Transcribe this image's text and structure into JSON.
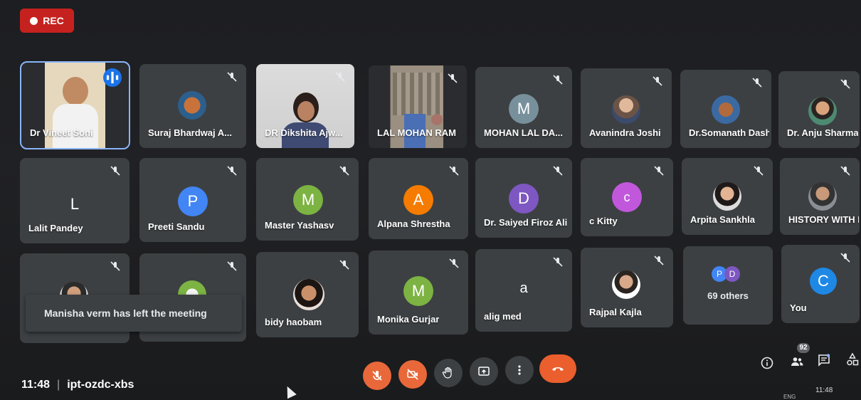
{
  "recording": {
    "label": "REC"
  },
  "participants": [
    {
      "name": "Dr Vineet Soni",
      "speaking": true
    },
    {
      "name": "Suraj Bhardwaj A..."
    },
    {
      "name": "DR Dikshita Ajw..."
    },
    {
      "name": "LAL MOHAN RAM"
    },
    {
      "name": "MOHAN LAL DA...",
      "initial": "M"
    },
    {
      "name": "Avanindra Joshi"
    },
    {
      "name": "Dr.Somanath Dash"
    },
    {
      "name": "Dr. Anju Sharma"
    },
    {
      "name": "Lalit Pandey",
      "initial": "L"
    },
    {
      "name": "Preeti Sandu",
      "initial": "P"
    },
    {
      "name": "Master Yashasv",
      "initial": "M"
    },
    {
      "name": "Alpana Shrestha",
      "initial": "A"
    },
    {
      "name": "Dr. Saiyed Firoz Ali",
      "initial": "D"
    },
    {
      "name": "c Kitty",
      "initial": "c"
    },
    {
      "name": "Arpita Sankhla"
    },
    {
      "name": "HISTORY WITH N..."
    },
    {
      "name": "bidy haobam"
    },
    {
      "name": "Monika Gurjar",
      "initial": "M"
    },
    {
      "name": "alig med",
      "initial": "a"
    },
    {
      "name": "Rajpal Kajla"
    },
    {
      "name": "You",
      "initial": "C"
    }
  ],
  "others": {
    "initials": [
      "P",
      "D"
    ],
    "label": "69 others"
  },
  "notification": "Manisha verm has left the meeting",
  "meeting": {
    "time": "11:48",
    "code": "ipt-ozdc-xbs"
  },
  "people_count": "92",
  "taskbar": {
    "time": "11:48",
    "lang": "ENG"
  },
  "colors": {
    "tile_bg": "#3c4043",
    "active_outline": "#8ab4f8",
    "rec_red": "#c5221f",
    "control_red": "#e8683a",
    "avatar_green": "#7cb342",
    "avatar_blue": "#4285f4",
    "avatar_purple": "#7e57c2",
    "avatar_orange": "#f57c00",
    "avatar_pink": "#c158dc"
  }
}
